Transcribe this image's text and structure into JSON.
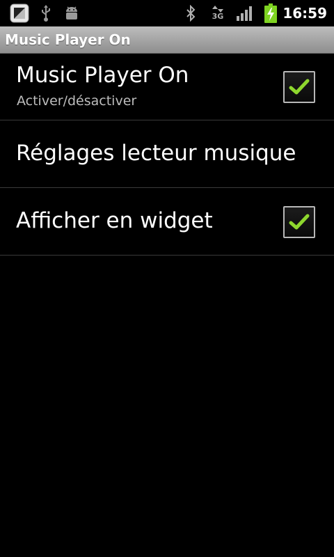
{
  "status_bar": {
    "time": "16:59",
    "network": "3G",
    "icons": [
      "notification-app-icon",
      "usb-icon",
      "android-debug-icon",
      "bluetooth-icon",
      "network-3g-icon",
      "signal-icon",
      "battery-charging-icon"
    ],
    "battery_color": "#7ed321"
  },
  "title_bar": {
    "title": "Music Player On"
  },
  "preferences": [
    {
      "title": "Music Player On",
      "summary": "Activer/désactiver",
      "checked": true
    },
    {
      "title": "Réglages lecteur musique"
    },
    {
      "title": "Afficher en widget",
      "checked": true
    }
  ],
  "colors": {
    "check_green": "#8ed72e",
    "divider": "#3a3a3a",
    "title_bar": "#a8a8a8"
  }
}
